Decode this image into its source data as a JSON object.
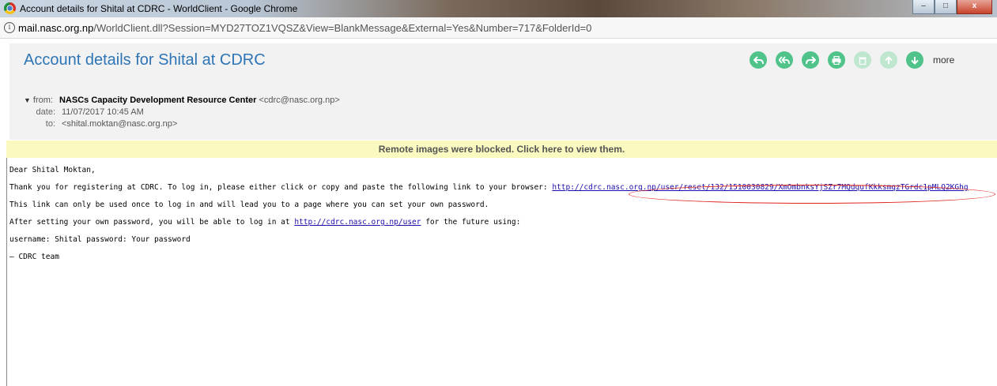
{
  "window": {
    "title": "Account details for Shital at CDRC - WorldClient - Google Chrome",
    "minimize": "–",
    "maximize": "□",
    "close": "x"
  },
  "address": {
    "host": "mail.nasc.org.np",
    "path": "/WorldClient.dll?Session=MYD27TOZ1VQSZ&View=BlankMessage&External=Yes&Number=717&FolderId=0"
  },
  "message": {
    "subject": "Account details for Shital at CDRC",
    "toolbar": {
      "reply_icon": "reply-icon",
      "reply_all_icon": "reply-all-icon",
      "forward_icon": "forward-icon",
      "print_icon": "print-icon",
      "delete_icon": "trash-icon",
      "up_icon": "arrow-up-icon",
      "down_icon": "arrow-down-icon",
      "more_label": "more"
    },
    "header": {
      "from_label": "from:",
      "from_name": "NASCs Capacity Development Resource Center",
      "from_email": "<cdrc@nasc.org.np>",
      "date_label": "date:",
      "date_value": "11/07/2017 10:45 AM",
      "to_label": "to:",
      "to_value": "<shital.moktan@nasc.org.np>"
    },
    "blocked_notice": "Remote images were blocked. Click here to view them.",
    "body": {
      "greeting": "Dear Shital Moktan,",
      "line1_text": "Thank you for registering at CDRC. To log in, please either click or copy and paste the following link to your browser: ",
      "reset_link": "http://cdrc.nasc.org.np/user/reset/132/1510030829/XmOmbnksYjSZr7MQdqufKkksmqzTGrdc1pMLQ2KGhg",
      "line2": "This link can only be used once to log in and will lead you to a page where you can set your own password.",
      "line3_before": "After setting your own password, you will be able to log in at ",
      "user_link": "http://cdrc.nasc.org.np/user",
      "line3_after": " for the future using:",
      "credentials": "username: Shital password: Your password",
      "signoff": "— CDRC team"
    }
  },
  "colors": {
    "subject": "#2e75b6",
    "toolbar_green": "#4fc38a",
    "blocked_bg": "#f9f9c0",
    "annotation_oval": "#e0241b"
  }
}
